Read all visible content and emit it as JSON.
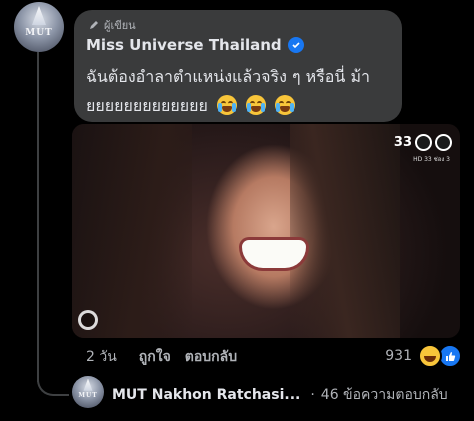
{
  "comment": {
    "author_badge": "ผู้เขียน",
    "author_name": "Miss Universe Thailand",
    "avatar_label": "MUT",
    "text_line1": "ฉันต้องอำลาตำแหน่งแล้วจริง ๆ หรือนี่ ม้า",
    "text_line2": "ยยยยยยยยยยยยย",
    "emojis": [
      "loudly-crying-face",
      "loudly-crying-face",
      "loudly-crying-face"
    ],
    "media": {
      "channel_number": "33",
      "channel_sub": "HD 33 ช่อง 3"
    },
    "time": "2 วัน",
    "like_label": "ถูกใจ",
    "reply_label": "ตอบกลับ",
    "reaction_count": "931",
    "reaction_icons": [
      "haha-icon",
      "like-icon"
    ]
  },
  "reply_preview": {
    "avatar_label": "MUT",
    "name": "MUT Nakhon Ratchasi...",
    "separator": "·",
    "count_text": "46 ข้อความตอบกลับ"
  },
  "colors": {
    "background": "#000000",
    "bubble": "#3a3b3c",
    "text_primary": "#e4e6eb",
    "text_secondary": "#b0b3b8",
    "verified": "#1877f2"
  }
}
